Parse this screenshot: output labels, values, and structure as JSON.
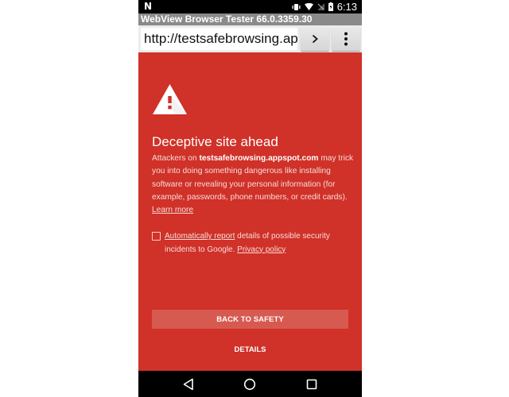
{
  "status_bar": {
    "notification_icon": "n-icon",
    "icons": [
      "vibrate-icon",
      "wifi-icon",
      "no-signal-icon",
      "battery-charging-icon"
    ],
    "time": "6:13"
  },
  "app": {
    "title": "WebView Browser Tester 66.0.3359.30"
  },
  "toolbar": {
    "url_value": "http://testsafebrowsing.appspot.com/",
    "url_display": "http://testsafebrowsing.ap",
    "go_label": ">",
    "menu_icon": "more-vert-icon"
  },
  "interstitial": {
    "icon": "warning-triangle-icon",
    "heading": "Deceptive site ahead",
    "body_prefix": "Attackers on ",
    "body_domain": "testsafebrowsing.appspot.com",
    "body_suffix": " may trick you into doing something dangerous like installing software or revealing your personal information (for example, passwords, phone numbers, or credit cards).",
    "learn_more": "Learn more",
    "report_checked": false,
    "report_link": "Automatically report",
    "report_text": " details of possible security incidents to Google. ",
    "privacy_link": "Privacy policy",
    "back_button": "BACK TO SAFETY",
    "details_button": "DETAILS"
  },
  "colors": {
    "background": "#d03128",
    "button": "#d75a51",
    "title_bar": "#8a8a8a"
  },
  "nav_bar": {
    "back": "back-icon",
    "home": "home-icon",
    "recents": "recents-icon"
  }
}
